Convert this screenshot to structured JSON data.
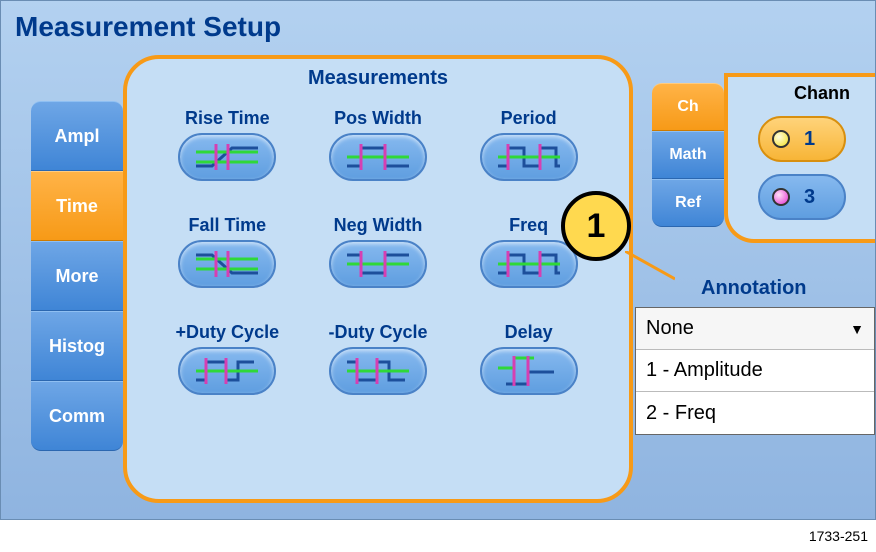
{
  "title": "Measurement Setup",
  "figure_id": "1733-251",
  "left_tabs": [
    {
      "id": "ampl",
      "label": "Ampl",
      "active": false
    },
    {
      "id": "time",
      "label": "Time",
      "active": true
    },
    {
      "id": "more",
      "label": "More",
      "active": false
    },
    {
      "id": "histog",
      "label": "Histog",
      "active": false
    },
    {
      "id": "comm",
      "label": "Comm",
      "active": false
    }
  ],
  "measurements_title": "Measurements",
  "measurements": [
    {
      "id": "rise-time",
      "label": "Rise Time"
    },
    {
      "id": "pos-width",
      "label": "Pos Width"
    },
    {
      "id": "period",
      "label": "Period"
    },
    {
      "id": "fall-time",
      "label": "Fall Time"
    },
    {
      "id": "neg-width",
      "label": "Neg Width"
    },
    {
      "id": "freq",
      "label": "Freq"
    },
    {
      "id": "pduty",
      "label": "+Duty Cycle"
    },
    {
      "id": "nduty",
      "label": "-Duty Cycle"
    },
    {
      "id": "delay",
      "label": "Delay"
    }
  ],
  "source_tabs": [
    {
      "id": "ch",
      "label": "Ch",
      "active": true
    },
    {
      "id": "math",
      "label": "Math",
      "active": false
    },
    {
      "id": "ref",
      "label": "Ref",
      "active": false
    }
  ],
  "channels_title": "Chann",
  "channels": [
    {
      "num": "1",
      "color": "yellow",
      "selected": true
    },
    {
      "num": "3",
      "color": "magenta",
      "selected": false
    }
  ],
  "callout": {
    "label": "1"
  },
  "annotation": {
    "title": "Annotation",
    "selected": "None",
    "options": [
      "1 - Amplitude",
      "2 - Freq"
    ]
  }
}
